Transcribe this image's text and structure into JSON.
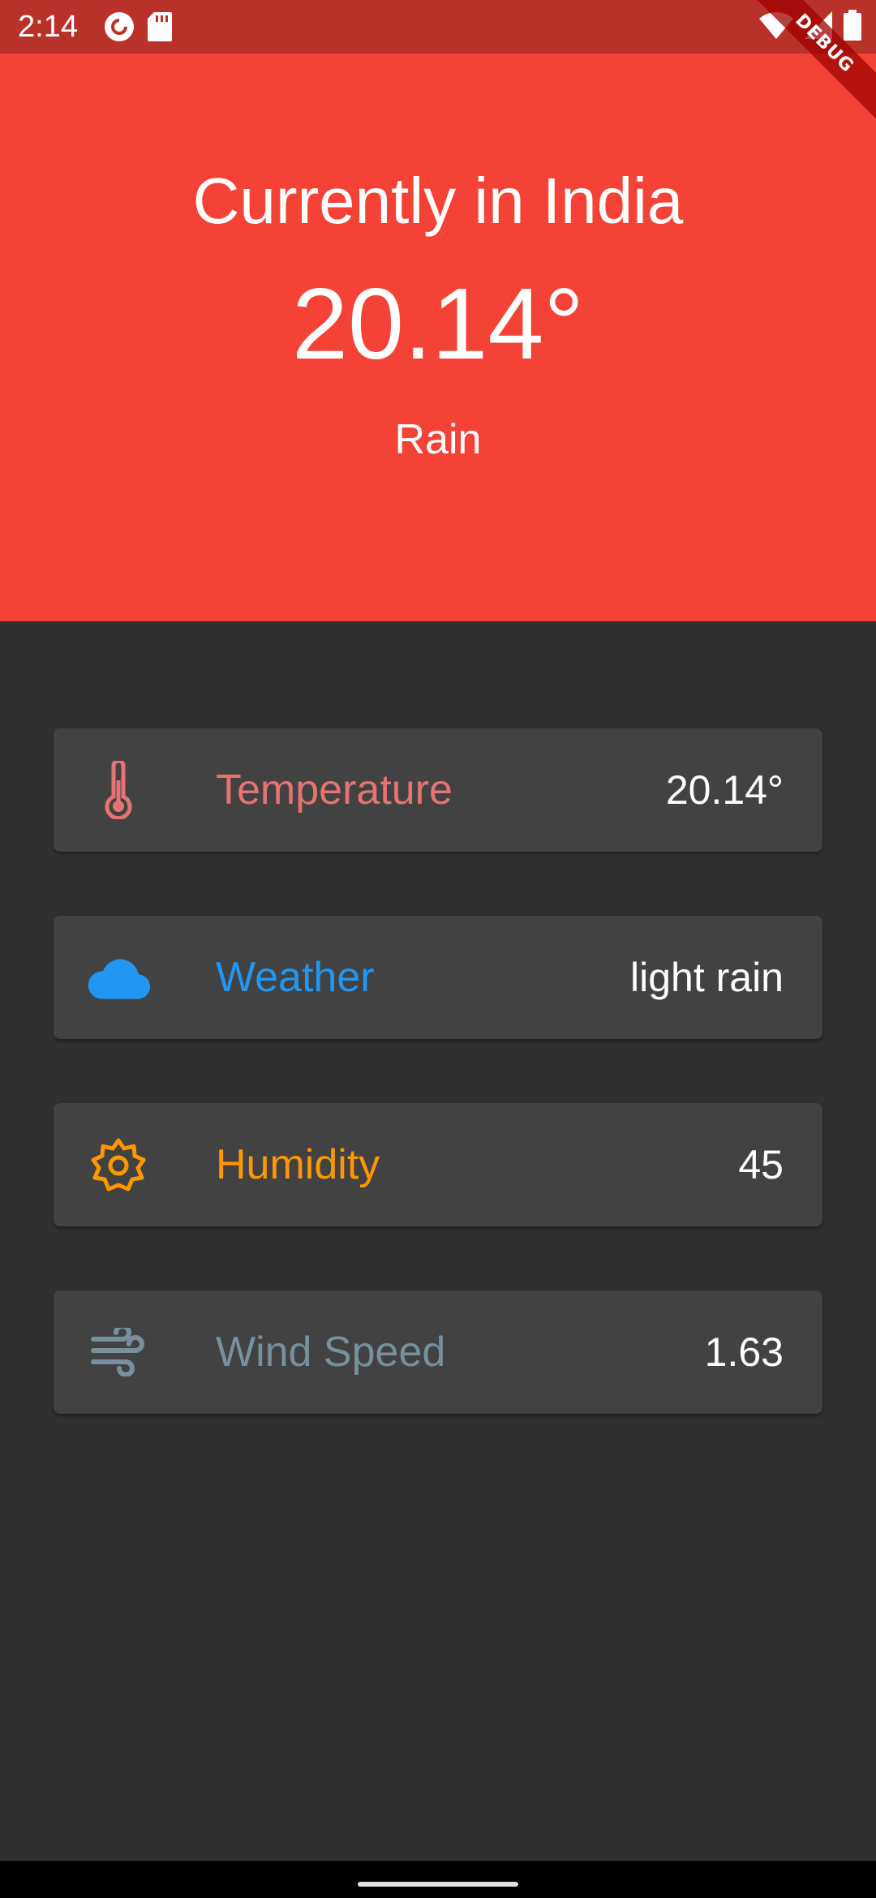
{
  "status_bar": {
    "time": "2:14",
    "icons": [
      "pocket-casts-icon",
      "sd-card-icon",
      "wifi-icon",
      "signal-icon",
      "battery-icon"
    ]
  },
  "debug_banner": {
    "label": "DEBUG"
  },
  "header": {
    "title": "Currently in India",
    "temperature": "20.14°",
    "condition": "Rain",
    "background_color": "#f44336"
  },
  "cards": [
    {
      "icon": "thermometer-icon",
      "label": "Temperature",
      "value": "20.14°",
      "color": "#e57373"
    },
    {
      "icon": "cloud-icon",
      "label": "Weather",
      "value": "light rain",
      "color": "#2196f3"
    },
    {
      "icon": "sun-icon",
      "label": "Humidity",
      "value": "45",
      "color": "#ff9800"
    },
    {
      "icon": "wind-icon",
      "label": "Wind Speed",
      "value": "1.63",
      "color": "#78909c"
    }
  ]
}
